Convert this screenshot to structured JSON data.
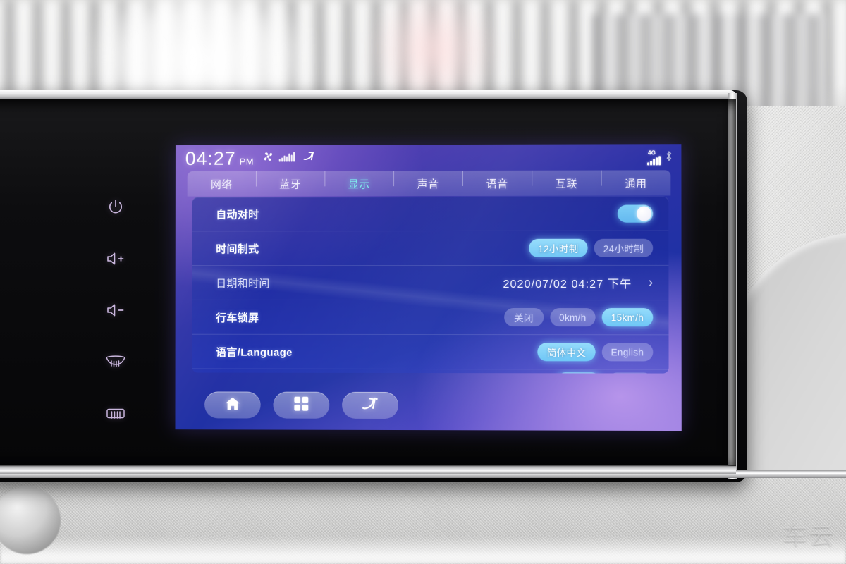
{
  "statusbar": {
    "time": "04:27",
    "ampm": "PM",
    "icons": [
      "fan-icon",
      "equalizer-icon",
      "airflow-icon"
    ],
    "network_badge": "4G",
    "signal_bars": 5,
    "bluetooth": "bluetooth-icon"
  },
  "tabs": [
    {
      "label": "网络",
      "active": false
    },
    {
      "label": "蓝牙",
      "active": false
    },
    {
      "label": "显示",
      "active": true
    },
    {
      "label": "声音",
      "active": false
    },
    {
      "label": "语音",
      "active": false
    },
    {
      "label": "互联",
      "active": false
    },
    {
      "label": "通用",
      "active": false
    }
  ],
  "settings": {
    "auto_time": {
      "label": "自动对时",
      "toggle_on": true
    },
    "time_format": {
      "label": "时间制式",
      "options": [
        {
          "label": "12小时制",
          "selected": true
        },
        {
          "label": "24小时制",
          "selected": false
        }
      ]
    },
    "date_time": {
      "label": "日期和时间",
      "value": "2020/07/02 04:27 下午",
      "chevron": "chevron-right-icon"
    },
    "drive_lock": {
      "label": "行车锁屏",
      "options": [
        {
          "label": "关闭",
          "selected": false
        },
        {
          "label": "0km/h",
          "selected": false
        },
        {
          "label": "15km/h",
          "selected": true
        }
      ]
    },
    "language": {
      "label": "语言/Language",
      "options": [
        {
          "label": "简体中文",
          "selected": true
        },
        {
          "label": "English",
          "selected": false
        }
      ]
    }
  },
  "dock": [
    {
      "icon": "home-icon",
      "name": "home"
    },
    {
      "icon": "apps-grid-icon",
      "name": "apps"
    },
    {
      "icon": "voice-assistant-icon",
      "name": "voice-assistant"
    }
  ],
  "hardkeys": [
    {
      "icon": "power-icon",
      "name": "power"
    },
    {
      "icon": "volume-up-icon",
      "name": "volume-up"
    },
    {
      "icon": "volume-down-icon",
      "name": "volume-down"
    },
    {
      "icon": "front-defrost-icon",
      "name": "front-defrost"
    },
    {
      "icon": "rear-defrost-icon",
      "name": "rear-defrost"
    }
  ],
  "watermark": "车云",
  "colors": {
    "accent_selected": "#7ccdf6",
    "tab_active": "#7ff2ef",
    "panel_bg": "#1c2896",
    "screen_bg": "#2c31a6"
  }
}
